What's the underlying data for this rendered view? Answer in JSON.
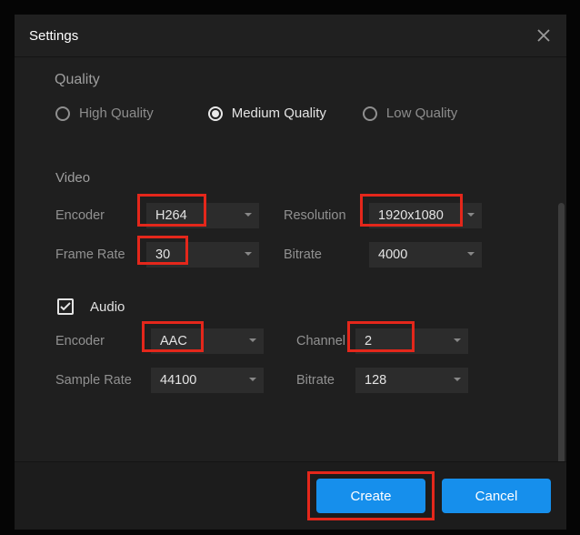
{
  "dialog": {
    "title": "Settings"
  },
  "quality": {
    "heading": "Quality",
    "options": {
      "high": "High Quality",
      "medium": "Medium Quality",
      "low": "Low Quality"
    },
    "selected": "medium"
  },
  "video": {
    "heading": "Video",
    "encoder_label": "Encoder",
    "encoder_value": "H264",
    "resolution_label": "Resolution",
    "resolution_value": "1920x1080",
    "framerate_label": "Frame Rate",
    "framerate_value": "30",
    "bitrate_label": "Bitrate",
    "bitrate_value": "4000"
  },
  "audio": {
    "heading": "Audio",
    "enabled": true,
    "encoder_label": "Encoder",
    "encoder_value": "AAC",
    "channel_label": "Channel",
    "channel_value": "2",
    "samplerate_label": "Sample Rate",
    "samplerate_value": "44100",
    "bitrate_label": "Bitrate",
    "bitrate_value": "128"
  },
  "footer": {
    "create": "Create",
    "cancel": "Cancel"
  }
}
